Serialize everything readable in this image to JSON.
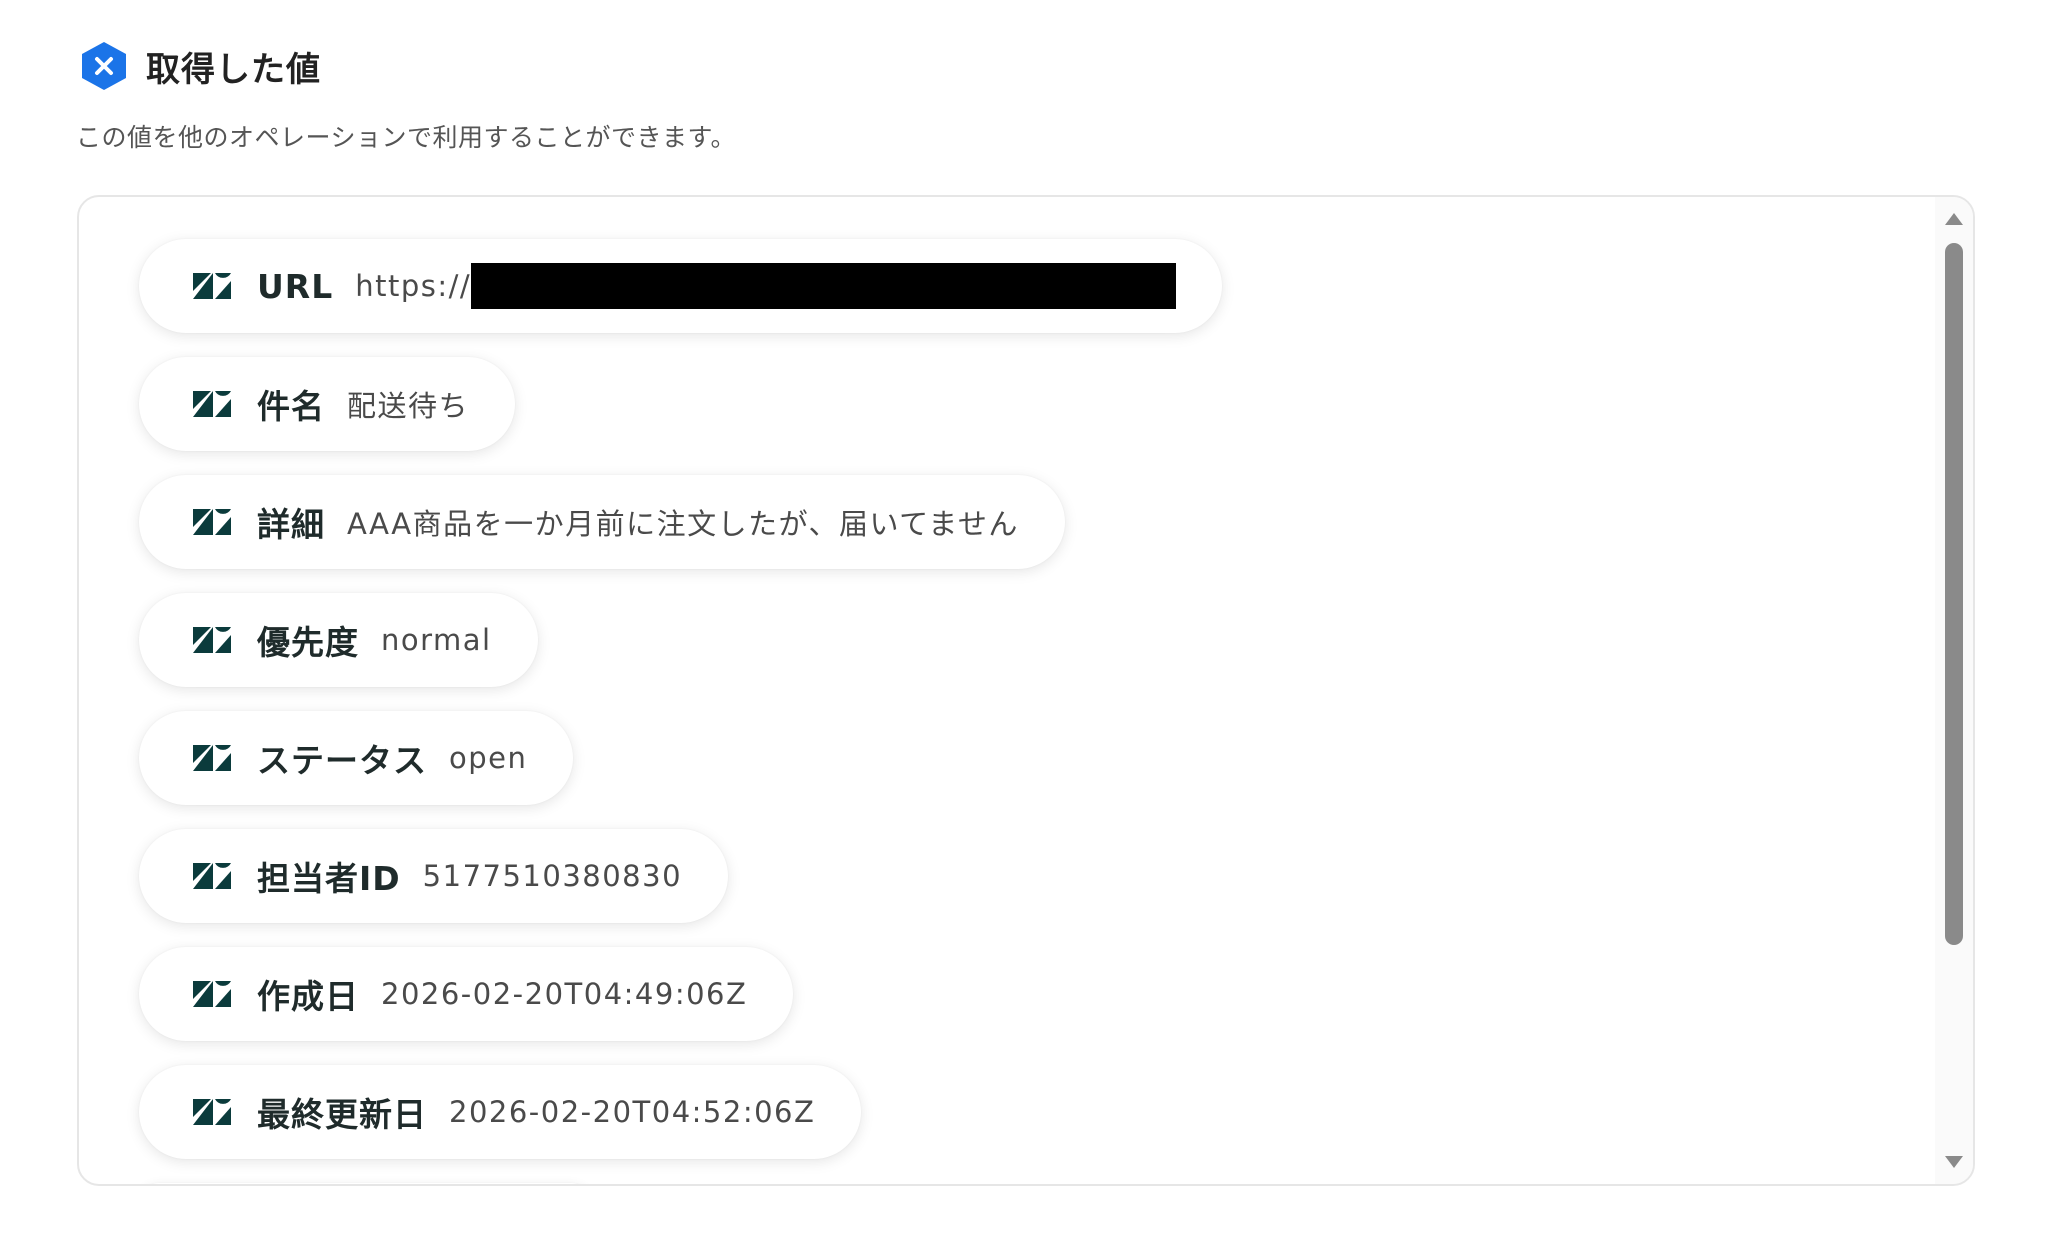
{
  "header": {
    "title": "取得した値",
    "icon": "blue-hexagon-x-icon",
    "subtitle": "この値を他のオペレーションで利用することができます。"
  },
  "colors": {
    "accent": "#1b74e8",
    "zendesk_icon": "#0b3b3c",
    "redaction": "#000000"
  },
  "items": [
    {
      "icon": "zendesk-icon",
      "label": "URL",
      "value": "https://"
    },
    {
      "icon": "zendesk-icon",
      "label": "件名",
      "value": "配送待ち"
    },
    {
      "icon": "zendesk-icon",
      "label": "詳細",
      "value": "AAA商品を一か月前に注文したが、届いてません"
    },
    {
      "icon": "zendesk-icon",
      "label": "優先度",
      "value": "normal"
    },
    {
      "icon": "zendesk-icon",
      "label": "ステータス",
      "value": "open"
    },
    {
      "icon": "zendesk-icon",
      "label": "担当者ID",
      "value": "5177510380830"
    },
    {
      "icon": "zendesk-icon",
      "label": "作成日",
      "value": "2026-02-20T04:49:06Z"
    },
    {
      "icon": "zendesk-icon",
      "label": "最終更新日",
      "value": "2026-02-20T04:52:06Z"
    }
  ]
}
